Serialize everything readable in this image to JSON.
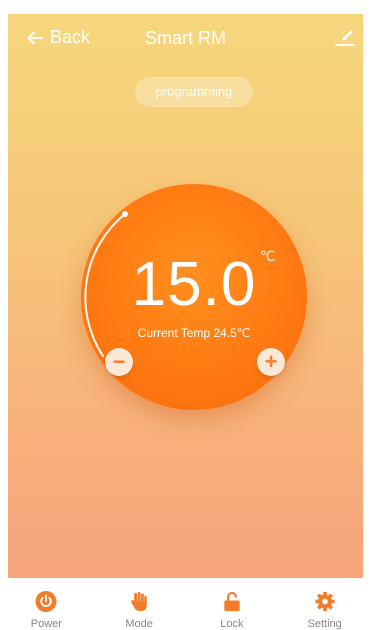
{
  "header": {
    "back_label": "Back",
    "title": "Smart RM",
    "icons": {
      "back": "arrow-left-icon",
      "edit": "pencil-icon"
    }
  },
  "mode_pill": "programming",
  "thermostat": {
    "setpoint": "15.0",
    "unit": "℃",
    "current_temp_text": "Current Temp  24.5℃",
    "decrease_label": "−",
    "increase_label": "+"
  },
  "tabs": [
    {
      "label": "Power",
      "icon": "power-icon"
    },
    {
      "label": "Mode",
      "icon": "hand-icon"
    },
    {
      "label": "Lock",
      "icon": "unlock-icon"
    },
    {
      "label": "Setting",
      "icon": "gear-icon"
    }
  ],
  "colors": {
    "accent": "#f47b2a",
    "dial": "#ff7a12",
    "background_top": "#f6d77c",
    "background_bottom": "#f6a47c"
  }
}
